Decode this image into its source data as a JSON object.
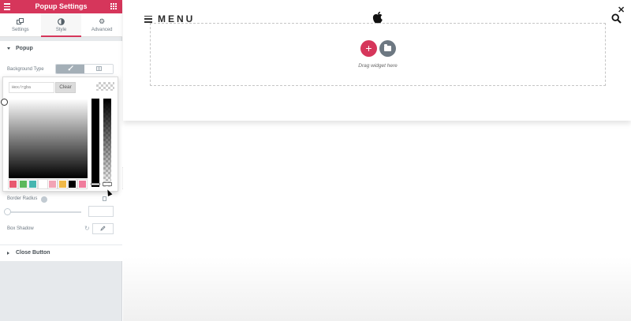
{
  "panel": {
    "title": "Popup Settings",
    "tabs": [
      {
        "label": "Settings",
        "icon": "settings-icon"
      },
      {
        "label": "Style",
        "icon": "style-contrast-icon",
        "active": true
      },
      {
        "label": "Advanced",
        "icon": "gear-icon"
      }
    ],
    "section_popup": "Popup",
    "background_type_label": "Background Type",
    "color_picker": {
      "hex_placeholder": "Hex/rgba",
      "clear_label": "Clear",
      "swatches": [
        "#e8596f",
        "#5cb85c",
        "#46b6b0",
        "#ffffff",
        "#f2a4b5",
        "#f0b847",
        "#000000",
        "#f07d9d"
      ]
    },
    "border_radius_label": "Border Radius",
    "box_shadow_label": "Box Shadow",
    "section_close_button": "Close Button"
  },
  "canvas": {
    "menu_label": "MENU",
    "close_symbol": "✕",
    "add_symbol": "+",
    "drag_hint": "Drag widget here"
  },
  "colors": {
    "accent": "#d6365b",
    "panel_bg": "#e6e9ec",
    "muted": "#6d7882"
  }
}
